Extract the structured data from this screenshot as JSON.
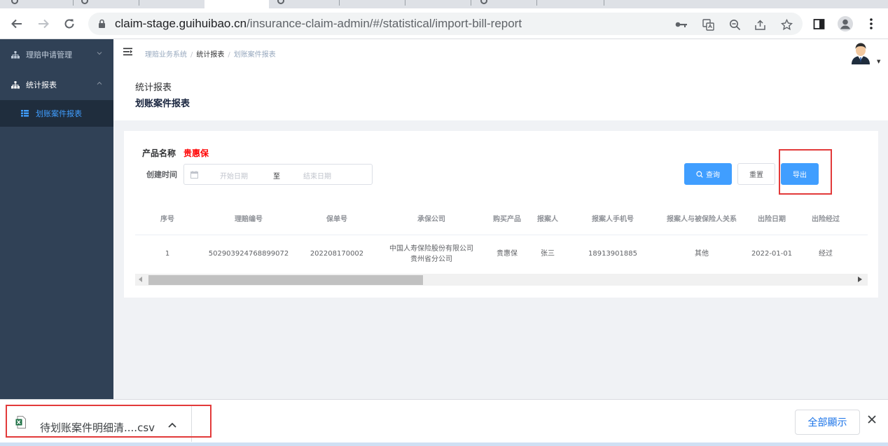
{
  "browser": {
    "url_domain": "claim-stage.guihuibao.cn",
    "url_path": "/insurance-claim-admin/#/statistical/import-bill-report"
  },
  "sidebar": {
    "items": [
      {
        "label": "理赔申请管理"
      },
      {
        "label": "统计报表"
      }
    ],
    "subitems": [
      {
        "label": "划账案件报表"
      }
    ]
  },
  "breadcrumb": {
    "items": [
      "理赔业务系统",
      "统计报表",
      "划账案件报表"
    ],
    "separator": "/"
  },
  "page_header": {
    "title": "统计报表",
    "subtitle": "划账案件报表"
  },
  "filters": {
    "product_label": "产品名称",
    "product_value": "贵惠保",
    "time_label": "创建时间",
    "start_placeholder": "开始日期",
    "range_separator": "至",
    "end_placeholder": "结束日期"
  },
  "buttons": {
    "search": "查询",
    "reset": "重置",
    "export": "导出"
  },
  "table": {
    "columns": [
      "序号",
      "理赔编号",
      "保单号",
      "承保公司",
      "购买产品",
      "报案人",
      "报案人手机号",
      "报案人与被保险人关系",
      "出险日期",
      "出险经过"
    ],
    "rows": [
      {
        "index": "1",
        "claim_no": "502903924768899072",
        "policy_no": "202208170002",
        "insurer_line1": "中国人寿保险股份有限公司",
        "insurer_line2": "贵州省分公司",
        "product": "贵惠保",
        "reporter": "张三",
        "phone": "18913901885",
        "relation": "其他",
        "date": "2022-01-01",
        "process": "经过"
      }
    ]
  },
  "download_bar": {
    "file_name": "待划账案件明细清....csv",
    "show_all": "全部顯示"
  },
  "colors": {
    "sidebar_bg": "#304156",
    "accent": "#409eff",
    "highlight_red": "#e23a3a",
    "product_red": "#ff0000"
  }
}
